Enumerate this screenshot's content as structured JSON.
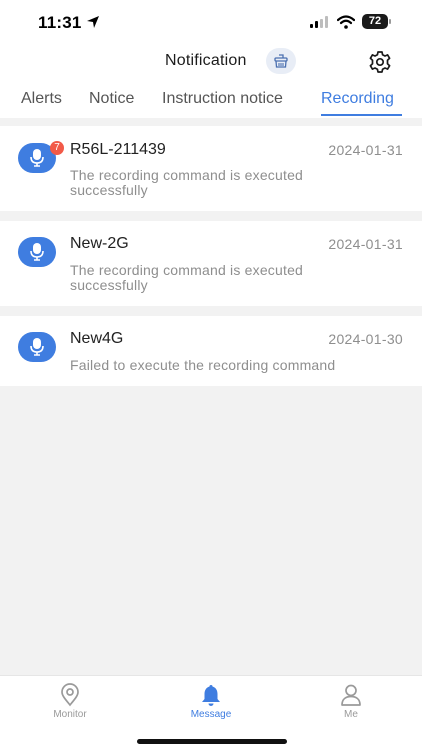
{
  "status_bar": {
    "time": "11:31",
    "battery": "72"
  },
  "header": {
    "title": "Notification",
    "icons": [
      "clear-basket-icon",
      "settings-gear-icon"
    ]
  },
  "tabs": [
    {
      "label": "Alerts",
      "active": false
    },
    {
      "label": "Notice",
      "active": false
    },
    {
      "label": "Instruction notice",
      "active": false
    },
    {
      "label": "Recording",
      "active": true
    }
  ],
  "colors": {
    "accent": "#3f7de0",
    "badge": "#f25a48",
    "background": "#f2f2f2"
  },
  "messages": [
    {
      "device": "R56L-211439",
      "date": "2024-01-31",
      "text_line1": "The recording command is executed",
      "text_line2": "successfully",
      "unread": "7",
      "icon": "microphone-icon"
    },
    {
      "device": "New-2G",
      "date": "2024-01-31",
      "text_line1": "The recording command is executed",
      "text_line2": "successfully",
      "icon": "microphone-icon"
    },
    {
      "device": "New4G",
      "date": "2024-01-30",
      "text_line1": "Failed to execute the recording command",
      "icon": "microphone-icon"
    }
  ],
  "bottom_nav": [
    {
      "label": "Monitor",
      "icon": "location-pin-icon",
      "active": false
    },
    {
      "label": "Message",
      "icon": "bell-icon",
      "active": true
    },
    {
      "label": "Me",
      "icon": "person-icon",
      "active": false
    }
  ]
}
